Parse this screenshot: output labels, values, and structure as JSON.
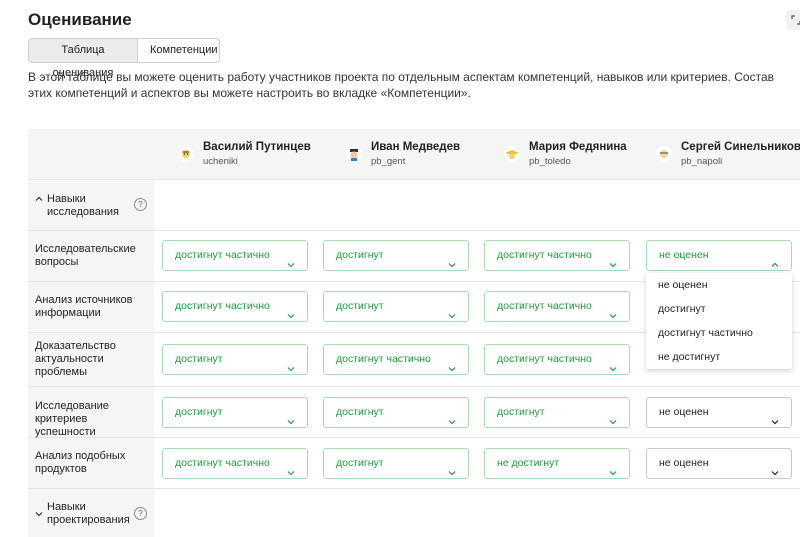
{
  "title": "Оценивание",
  "tabs": [
    "Таблица оценивания",
    "Компетенции"
  ],
  "description": "В этой таблице вы можете оценить работу участников проекта по отдельным аспектам компетенций, навыков или критериев. Состав этих компетенций и аспектов вы можете настроить во вкладке «Компетенции».",
  "people": [
    {
      "name": "Василий Путинцев",
      "username": "ucheniki"
    },
    {
      "name": "Иван Медведев",
      "username": "pb_gent"
    },
    {
      "name": "Мария Федянина",
      "username": "pb_toledo"
    },
    {
      "name": "Сергей Синельников",
      "username": "pb_napoli"
    }
  ],
  "groups": [
    {
      "label": "Навыки исследования",
      "help": "?"
    },
    {
      "label": "Навыки проектирования",
      "help": "?"
    }
  ],
  "criteria": [
    {
      "label": "Исследовательские вопросы",
      "grades": [
        "достигнут частично",
        "достигнут",
        "достигнут частично",
        "не оценен"
      ]
    },
    {
      "label": "Анализ источников информации",
      "grades": [
        "достигнут частично",
        "достигнут",
        "достигнут частично",
        ""
      ]
    },
    {
      "label": "Доказательство актуальности проблемы",
      "grades": [
        "достигнут",
        "достигнут частично",
        "достигнут частично",
        ""
      ]
    },
    {
      "label": "Исследование критериев успешности",
      "grades": [
        "достигнут",
        "достигнут",
        "достигнут",
        "не оценен"
      ]
    },
    {
      "label": "Анализ подобных продуктов",
      "grades": [
        "достигнут частично",
        "достигнут",
        "не достигнут",
        "не оценен"
      ]
    }
  ],
  "dropdown_options": [
    "не оценен",
    "достигнут",
    "достигнут частично",
    "не достигнут"
  ],
  "colors": {
    "accent": "#1e9c3c",
    "accent_border": "#a6dcb1",
    "band": "#f5f5f5"
  }
}
